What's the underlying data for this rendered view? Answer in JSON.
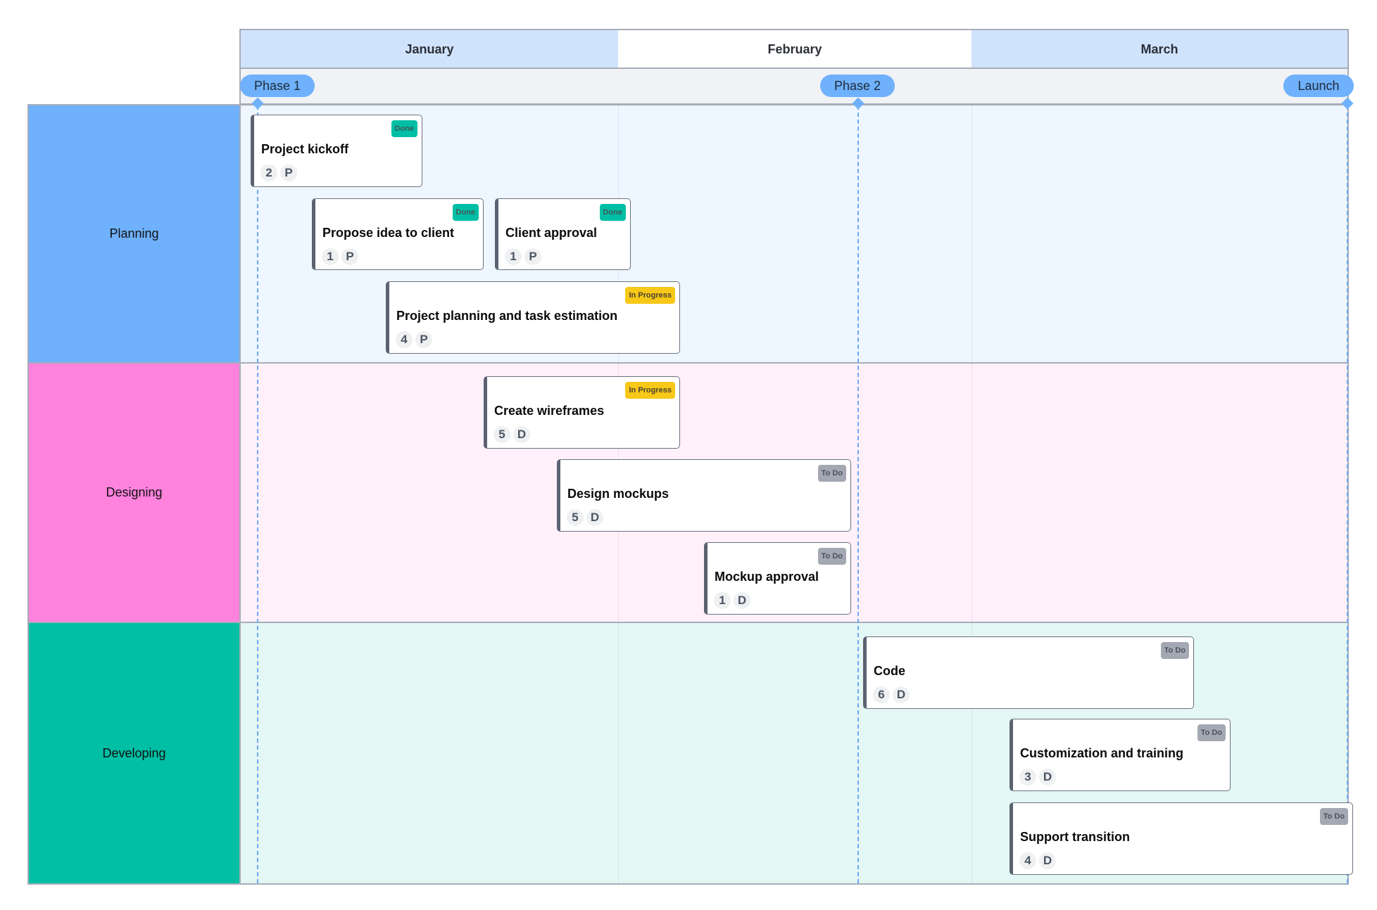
{
  "timeline": {
    "months": [
      "January",
      "February",
      "March"
    ],
    "milestones": [
      {
        "label": "Phase 1"
      },
      {
        "label": "Phase 2"
      },
      {
        "label": "Launch"
      }
    ]
  },
  "colors": {
    "planning": "#6fb1fc",
    "designing": "#ff82dd",
    "developing": "#00bfa5",
    "done": "#00bfa5",
    "in_progress": "#f7c817",
    "todo": "#a3a8b2",
    "milestone": "#6fb1fc"
  },
  "lanes": [
    {
      "label": "Planning",
      "tasks": [
        {
          "title": "Project kickoff",
          "status": "Done",
          "count": "2",
          "tag": "P"
        },
        {
          "title": "Propose idea to client",
          "status": "Done",
          "count": "1",
          "tag": "P"
        },
        {
          "title": "Client approval",
          "status": "Done",
          "count": "1",
          "tag": "P"
        },
        {
          "title": "Project planning and task estimation",
          "status": "In Progress",
          "count": "4",
          "tag": "P"
        }
      ]
    },
    {
      "label": "Designing",
      "tasks": [
        {
          "title": "Create wireframes",
          "status": "In Progress",
          "count": "5",
          "tag": "D"
        },
        {
          "title": "Design mockups",
          "status": "To Do",
          "count": "5",
          "tag": "D"
        },
        {
          "title": "Mockup approval",
          "status": "To Do",
          "count": "1",
          "tag": "D"
        }
      ]
    },
    {
      "label": "Developing",
      "tasks": [
        {
          "title": "Code",
          "status": "To Do",
          "count": "6",
          "tag": "D"
        },
        {
          "title": "Customization and training",
          "status": "To Do",
          "count": "3",
          "tag": "D"
        },
        {
          "title": "Support transition",
          "status": "To Do",
          "count": "4",
          "tag": "D"
        }
      ]
    }
  ]
}
